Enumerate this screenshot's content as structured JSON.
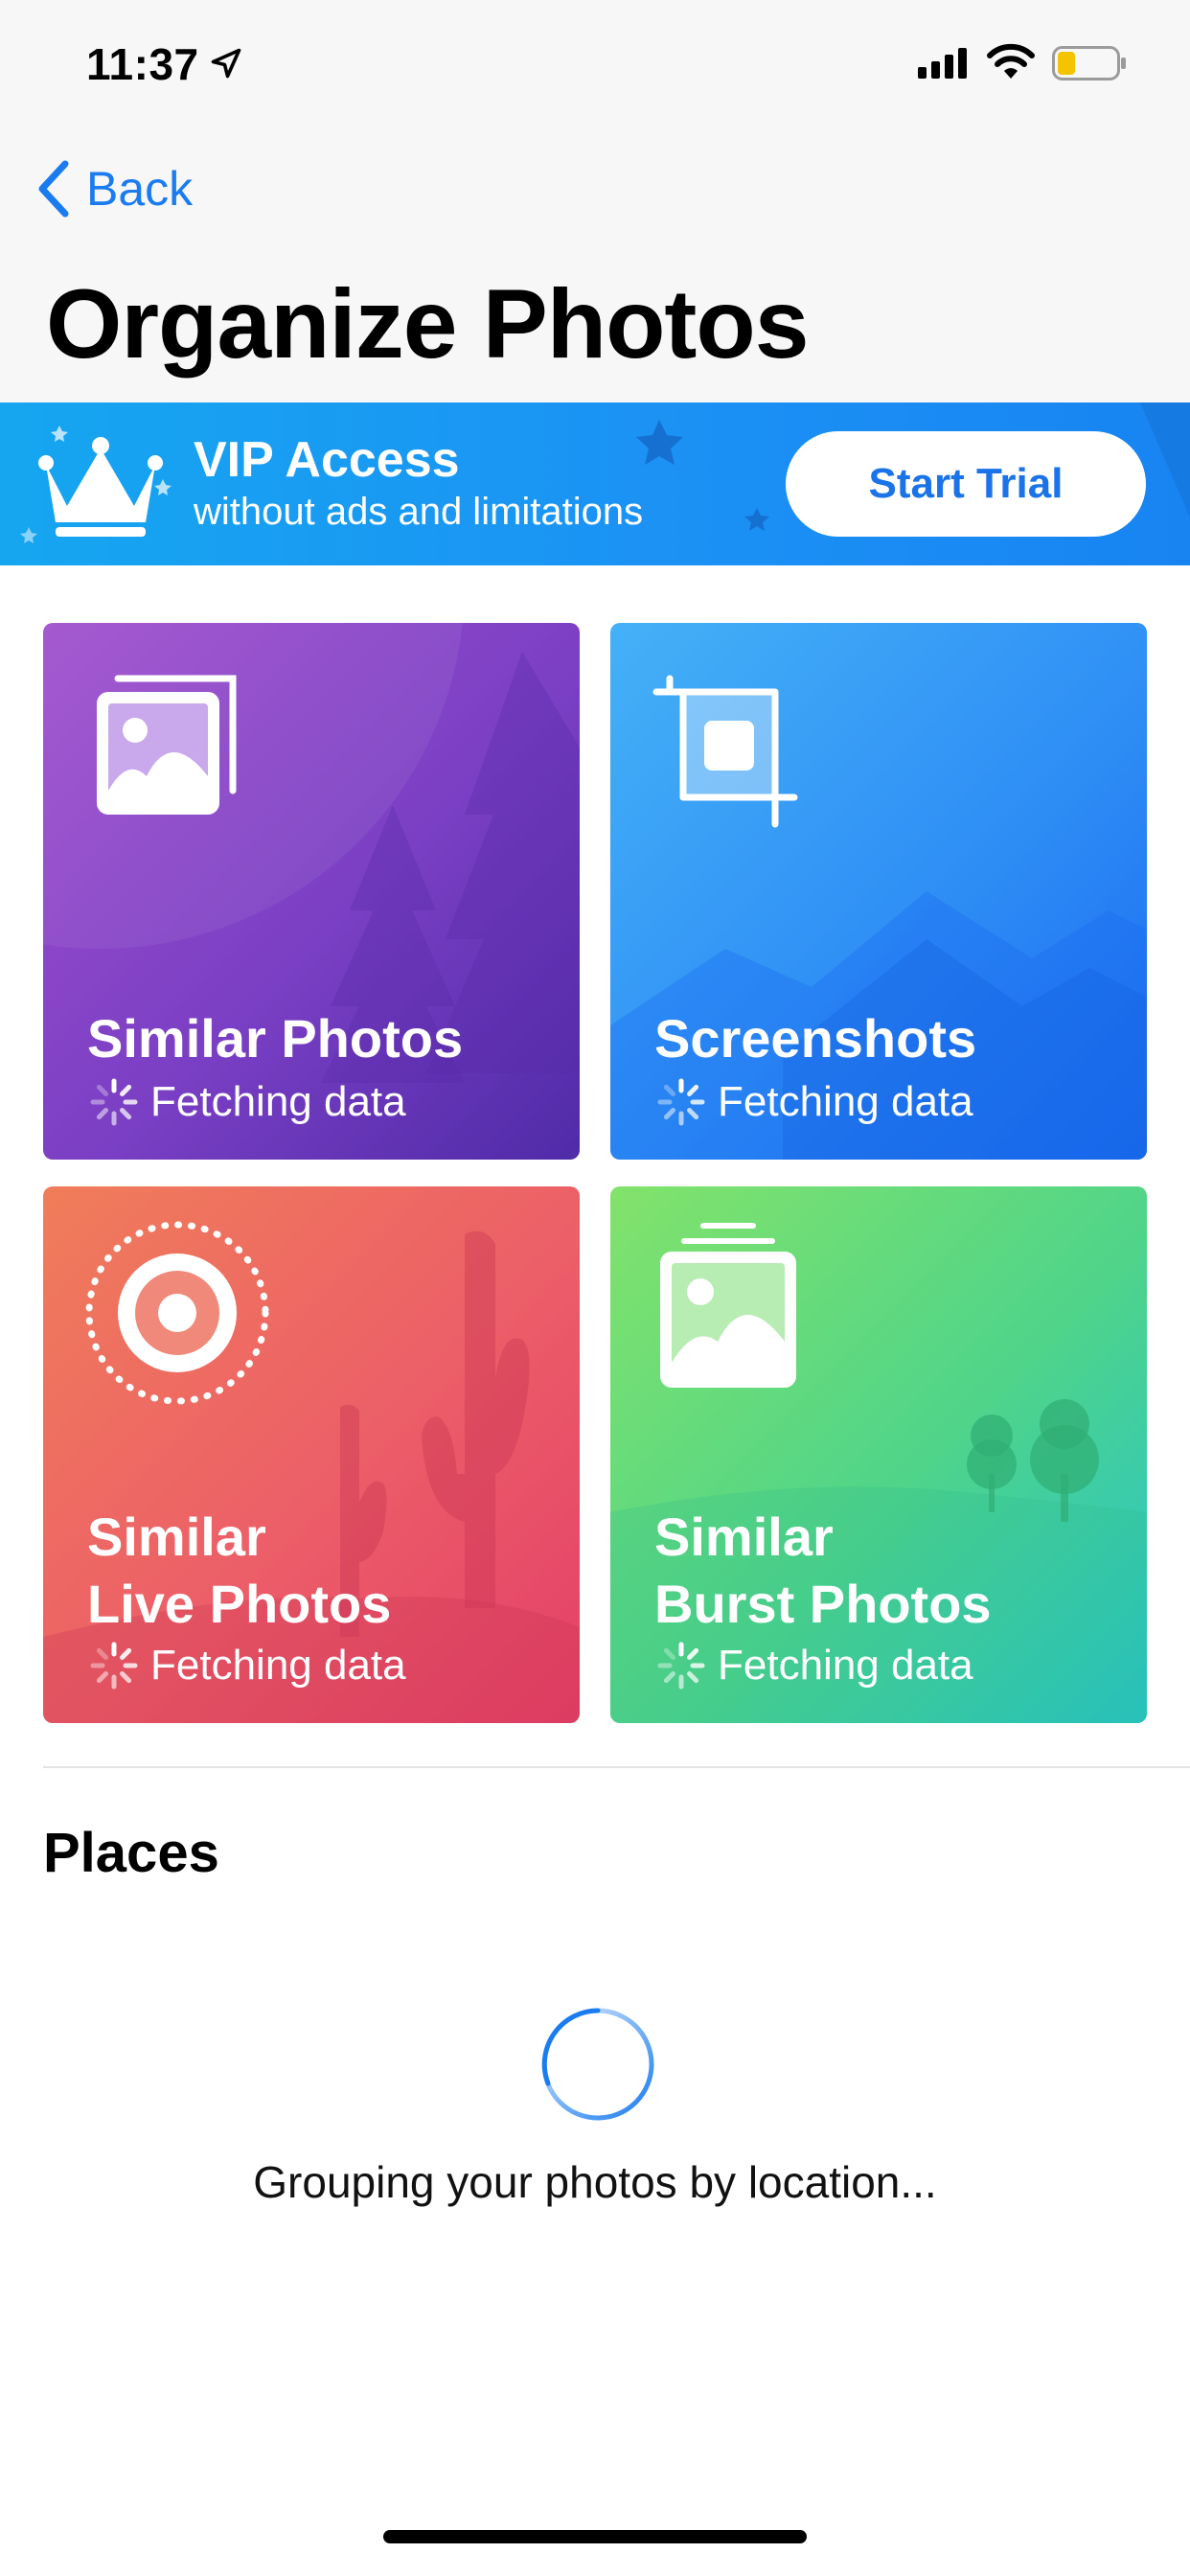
{
  "status_bar": {
    "time": "11:37",
    "icons": [
      "location-arrow-icon",
      "signal-icon",
      "wifi-icon",
      "battery-icon"
    ],
    "battery_color": "#f5c400"
  },
  "nav": {
    "back_label": "Back",
    "title": "Organize Photos",
    "accent_color": "#1a7cf0"
  },
  "vip_banner": {
    "title": "VIP Access",
    "subtitle": "without ads and limitations",
    "button_label": "Start Trial",
    "icon": "crown-icon"
  },
  "cards": [
    {
      "title_line1": "Similar Photos",
      "title_line2": "",
      "status": "Fetching data",
      "icon": "stacked-photos-icon",
      "color": "#7a3fc4"
    },
    {
      "title_line1": "Screenshots",
      "title_line2": "",
      "status": "Fetching data",
      "icon": "crop-icon",
      "color": "#2f8ff5"
    },
    {
      "title_line1": "Similar",
      "title_line2": "Live Photos",
      "status": "Fetching data",
      "icon": "live-photo-icon",
      "color": "#ec5e68"
    },
    {
      "title_line1": "Similar",
      "title_line2": "Burst Photos",
      "status": "Fetching data",
      "icon": "burst-photos-icon",
      "color": "#4fd48a"
    }
  ],
  "places": {
    "title": "Places",
    "loading_text": "Grouping your photos by location..."
  }
}
